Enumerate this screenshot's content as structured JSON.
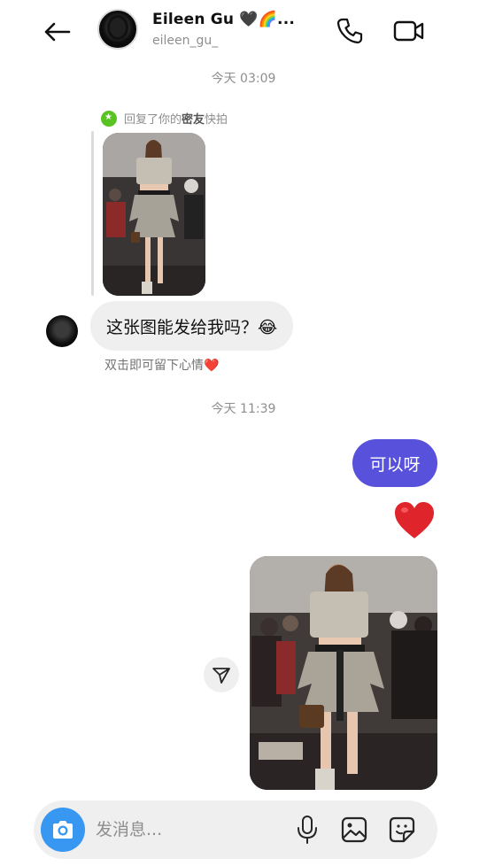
{
  "header": {
    "name": "Eileen Gu 🖤🌈...",
    "username": "eileen_gu_"
  },
  "chat": {
    "timestamp_1": "今天 03:09",
    "reply_note_prefix": "回复了你的",
    "reply_note_bold": "密友",
    "reply_note_suffix": "快拍",
    "incoming_message": "这张图能发给我吗？😂",
    "double_tap_hint": "双击即可留下心情❤️",
    "timestamp_2": "今天 11:39",
    "outgoing_message": "可以呀"
  },
  "composer": {
    "placeholder": "发消息..."
  },
  "colors": {
    "outgoing_bubble": "#5851db",
    "camera_button": "#3897f0",
    "heart": "#e0242b",
    "close_friends_badge": "#58c322"
  },
  "icons": [
    "back-arrow-icon",
    "phone-icon",
    "video-camera-icon",
    "close-friends-star-icon",
    "heart-icon",
    "share-icon",
    "camera-icon",
    "microphone-icon",
    "gallery-icon",
    "sticker-icon"
  ]
}
